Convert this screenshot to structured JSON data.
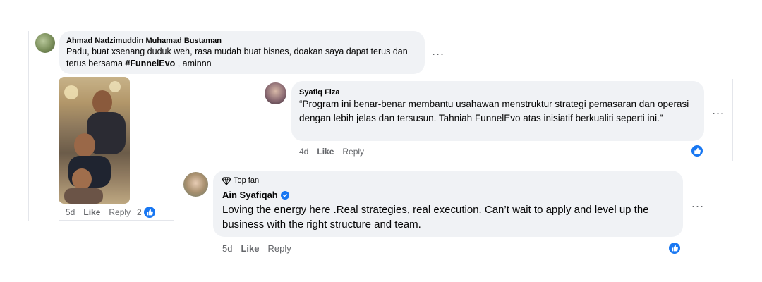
{
  "comment1": {
    "author": "Ahmad Nadzimuddin Muhamad Bustaman",
    "text_before": "Padu, buat xsenang duduk weh, rasa mudah buat bisnes, doakan saya dapat terus dan terus bersama ",
    "hashtag": "#FunnelEvo",
    "text_after": " , aminnn",
    "time": "5d",
    "like_label": "Like",
    "reply_label": "Reply",
    "reaction_count": "2",
    "more": "..."
  },
  "comment2": {
    "author": "Syafiq Fiza",
    "text": "“Program ini benar-benar membantu usahawan menstruktur strategi pemasaran dan operasi dengan lebih jelas dan tersusun. Tahniah FunnelEvo atas inisiatif berkualiti seperti ini.”",
    "time": "4d",
    "like_label": "Like",
    "reply_label": "Reply",
    "more": "..."
  },
  "comment3": {
    "badge": "Top fan",
    "author": "Ain Syafiqah",
    "text": "Loving the energy here .Real strategies, real execution. Can’t wait to apply and level up the business with the right structure and team.",
    "time": "5d",
    "like_label": "Like",
    "reply_label": "Reply",
    "more": "..."
  },
  "colors": {
    "like_blue": "#1877f2",
    "bubble": "#f0f2f5",
    "meta": "#65676b"
  },
  "icons": {
    "like": "thumbs-up-icon",
    "verified": "verified-badge-icon",
    "top_fan": "diamond-icon"
  }
}
